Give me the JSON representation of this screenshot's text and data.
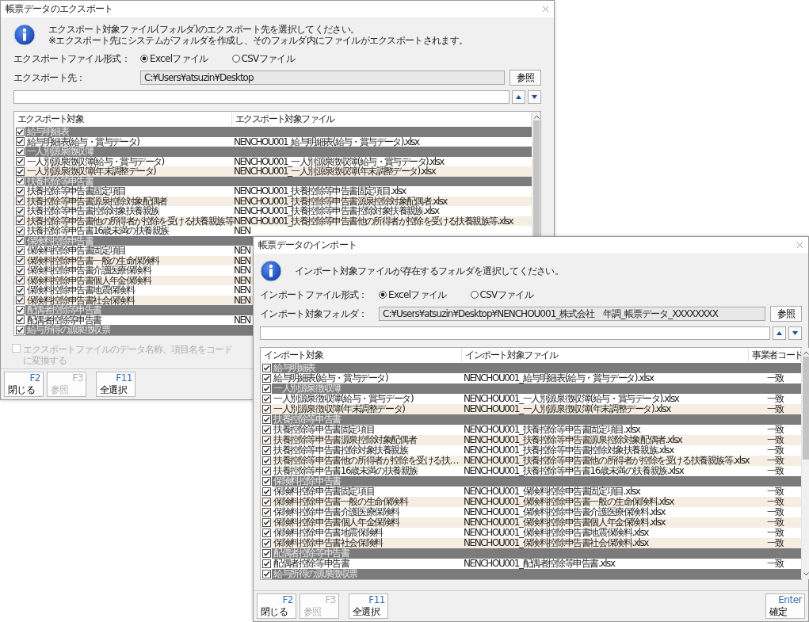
{
  "export_window": {
    "title": "帳票データのエクスポート",
    "message_lines": [
      "エクスポート対象ファイル(フォルダ)のエクスポート先を選択してください。",
      "※エクスポート先にシステムがフォルダを作成し、そのフォルダ内にファイルがエクスポートされます。"
    ],
    "format": {
      "label": "エクスポートファイル形式：",
      "options": [
        {
          "label": "Excelファイル",
          "selected": true
        },
        {
          "label": "CSVファイル",
          "selected": false
        }
      ]
    },
    "destination": {
      "label": "エクスポート先：",
      "value": "C:¥Users¥atsuzin¥Desktop"
    },
    "browse_button": "参照",
    "list": {
      "columns": [
        "エクスポート対象",
        "エクスポート対象ファイル"
      ],
      "rows": [
        {
          "kind": "group",
          "label": "給与明細表",
          "checked": true
        },
        {
          "kind": "item",
          "label": "給与明細表(給与・賞与データ)",
          "file": "NENCHOU001_給与明細表(給与・賞与データ).xlsx",
          "checked": true
        },
        {
          "kind": "group",
          "label": "一人別源泉徴収簿",
          "checked": true
        },
        {
          "kind": "item",
          "label": "一人別源泉徴収簿(給与・賞与データ)",
          "file": "NENCHOU001_一人別源泉徴収簿(給与・賞与データ).xlsx",
          "checked": true
        },
        {
          "kind": "item",
          "label": "一人別源泉徴収簿(年末調整データ)",
          "file": "NENCHOU001_一人別源泉徴収簿(年末調整データ).xlsx",
          "checked": true
        },
        {
          "kind": "group",
          "label": "扶養控除等申告書",
          "checked": true
        },
        {
          "kind": "item",
          "label": "扶養控除等申告書固定項目",
          "file": "NENCHOU001_扶養控除等申告書固定項目.xlsx",
          "checked": true
        },
        {
          "kind": "item",
          "label": "扶養控除等申告書源泉控除対象配偶者",
          "file": "NENCHOU001_扶養控除等申告書源泉控除対象配偶者.xlsx",
          "checked": true
        },
        {
          "kind": "item",
          "label": "扶養控除等申告書控除対象扶養親族",
          "file": "NENCHOU001_扶養控除等申告書控除対象扶養親族.xlsx",
          "checked": true
        },
        {
          "kind": "item",
          "label": "扶養控除等申告書他の所得者が控除を受ける扶養親族等",
          "file": "NENCHOU001_扶養控除等申告書他の所得者が控除を受ける扶養親族等.xlsx",
          "checked": true
        },
        {
          "kind": "item",
          "label": "扶養控除等申告書16歳未満の扶養親族",
          "file": "NEN",
          "checked": true
        },
        {
          "kind": "group",
          "label": "保険料控除申告書",
          "checked": true
        },
        {
          "kind": "item",
          "label": "保険料控除申告書固定項目",
          "file": "NEN",
          "checked": true
        },
        {
          "kind": "item",
          "label": "保険料控除申告書一般の生命保険料",
          "file": "NEN",
          "checked": true
        },
        {
          "kind": "item",
          "label": "保険料控除申告書介護医療保険料",
          "file": "NEN",
          "checked": true
        },
        {
          "kind": "item",
          "label": "保険料控除申告書個人年金保険料",
          "file": "NEN",
          "checked": true
        },
        {
          "kind": "item",
          "label": "保険料控除申告書地震保険料",
          "file": "NEN",
          "checked": true
        },
        {
          "kind": "item",
          "label": "保険料控除申告書社会保険料",
          "file": "NEN",
          "checked": true
        },
        {
          "kind": "group",
          "label": "配偶者控除等申告書",
          "checked": true
        },
        {
          "kind": "item",
          "label": "配偶者控除等申告書",
          "file": "NEN",
          "checked": true
        },
        {
          "kind": "group",
          "label": "給与所得の源泉徴収票",
          "checked": true
        }
      ]
    },
    "option_checkbox": {
      "label": "エクスポートファイルのデータ名称、項目名をコードに変換する",
      "checked": false,
      "disabled": true
    },
    "buttons": [
      {
        "key": "F2",
        "label": "閉じる",
        "disabled": false
      },
      {
        "key": "F3",
        "label": "参照",
        "disabled": true
      },
      {
        "key": "F11",
        "label": "全選択",
        "disabled": false
      }
    ]
  },
  "import_window": {
    "title": "帳票データのインポート",
    "message_lines": [
      "インポート対象ファイルが存在するフォルダを選択してください。"
    ],
    "format": {
      "label": "インポートファイル形式：",
      "options": [
        {
          "label": "Excelファイル",
          "selected": true
        },
        {
          "label": "CSVファイル",
          "selected": false
        }
      ]
    },
    "destination": {
      "label": "インポート対象フォルダ：",
      "value": "C:¥Users¥atsuzin¥Desktop¥NENCHOU001_株式会社　年調_帳票データ_XXXXXXXX"
    },
    "browse_button": "参照",
    "list": {
      "columns": [
        "インポート対象",
        "インポート対象ファイル",
        "事業者コード"
      ],
      "rows": [
        {
          "kind": "group",
          "label": "給与明細表",
          "checked": true
        },
        {
          "kind": "item",
          "label": "給与明細表(給与・賞与データ)",
          "file": "NENCHOU001_給与明細表(給与・賞与データ).xlsx",
          "code": "一致",
          "checked": true
        },
        {
          "kind": "group",
          "label": "一人別源泉徴収簿",
          "checked": true
        },
        {
          "kind": "item",
          "label": "一人別源泉徴収簿(給与・賞与データ)",
          "file": "NENCHOU001_一人別源泉徴収簿(給与・賞与データ).xlsx",
          "code": "一致",
          "checked": true
        },
        {
          "kind": "item",
          "label": "一人別源泉徴収簿(年末調整データ)",
          "file": "NENCHOU001_一人別源泉徴収簿(年末調整データ).xlsx",
          "code": "一致",
          "checked": true
        },
        {
          "kind": "group",
          "label": "扶養控除等申告書",
          "checked": true
        },
        {
          "kind": "item",
          "label": "扶養控除等申告書固定項目",
          "file": "NENCHOU001_扶養控除等申告書固定項目.xlsx",
          "code": "一致",
          "checked": true
        },
        {
          "kind": "item",
          "label": "扶養控除等申告書源泉控除対象配偶者",
          "file": "NENCHOU001_扶養控除等申告書源泉控除対象配偶者.xlsx",
          "code": "一致",
          "checked": true
        },
        {
          "kind": "item",
          "label": "扶養控除等申告書控除対象扶養親族",
          "file": "NENCHOU001_扶養控除等申告書控除対象扶養親族.xlsx",
          "code": "一致",
          "checked": true
        },
        {
          "kind": "item",
          "label": "扶養控除等申告書他の所得者が控除を受ける扶…",
          "file": "NENCHOU001_扶養控除等申告書他の所得者が控除を受ける扶養親族等.xlsx",
          "code": "一致",
          "checked": true
        },
        {
          "kind": "item",
          "label": "扶養控除等申告書16歳未満の扶養親族",
          "file": "NENCHOU001_扶養控除等申告書16歳未満の扶養親族.xlsx",
          "code": "一致",
          "checked": true
        },
        {
          "kind": "group",
          "label": "保険料控除申告書",
          "checked": true
        },
        {
          "kind": "item",
          "label": "保険料控除申告書固定項目",
          "file": "NENCHOU001_保険料控除申告書固定項目.xlsx",
          "code": "一致",
          "checked": true
        },
        {
          "kind": "item",
          "label": "保険料控除申告書一般の生命保険料",
          "file": "NENCHOU001_保険料控除申告書一般の生命保険料.xlsx",
          "code": "一致",
          "checked": true
        },
        {
          "kind": "item",
          "label": "保険料控除申告書介護医療保険料",
          "file": "NENCHOU001_保険料控除申告書介護医療保険料.xlsx",
          "code": "一致",
          "checked": true
        },
        {
          "kind": "item",
          "label": "保険料控除申告書個人年金保険料",
          "file": "NENCHOU001_保険料控除申告書個人年金保険料.xlsx",
          "code": "一致",
          "checked": true
        },
        {
          "kind": "item",
          "label": "保険料控除申告書地震保険料",
          "file": "NENCHOU001_保険料控除申告書地震保険料.xlsx",
          "code": "一致",
          "checked": true
        },
        {
          "kind": "item",
          "label": "保険料控除申告書社会保険料",
          "file": "NENCHOU001_保険料控除申告書社会保険料.xlsx",
          "code": "一致",
          "checked": true
        },
        {
          "kind": "group",
          "label": "配偶者控除等申告書",
          "checked": true
        },
        {
          "kind": "item",
          "label": "配偶者控除等申告書",
          "file": "NENCHOU001_配偶者控除等申告書.xlsx",
          "code": "一致",
          "checked": true
        },
        {
          "kind": "group",
          "label": "給与所得の源泉徴収票",
          "checked": true
        }
      ]
    },
    "buttons": [
      {
        "key": "F2",
        "label": "閉じる",
        "disabled": false
      },
      {
        "key": "F3",
        "label": "参照",
        "disabled": true
      },
      {
        "key": "F11",
        "label": "全選択",
        "disabled": false
      }
    ],
    "confirm_button": {
      "key": "Enter",
      "label": "確定",
      "disabled": false
    }
  }
}
